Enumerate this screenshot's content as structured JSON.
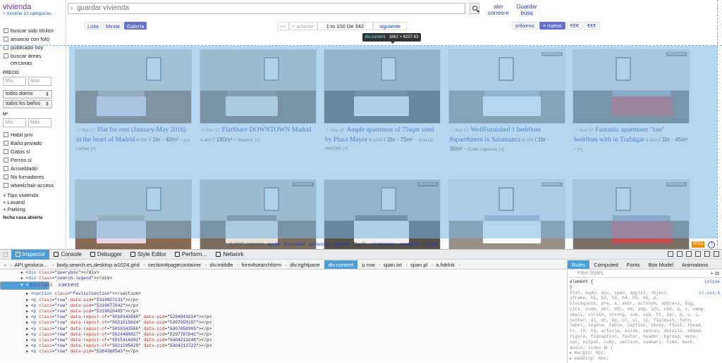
{
  "sidebar": {
    "category": "vivienda",
    "more_link": "+ mostrar 12 categorías",
    "checks1": [
      "buscar solo títulos",
      "anuncio con foto",
      "publicado hoy",
      "buscar áreas cercanas"
    ],
    "price_label": "PRECIO",
    "min": "Mín.",
    "max": "Máx.",
    "bedrooms": "todos dorms",
    "baths": "todos los baños",
    "m2_label": "M²",
    "checks2": [
      "Habit priv",
      "Baño privado",
      "Gatos sí",
      "Perros sí",
      "Amueblado",
      "No fumadores",
      "wheelchair access"
    ],
    "expanders": [
      "+ Tipo vivienda",
      "+ Lavand",
      "+ Parking"
    ],
    "cut_text": "fecha casa abierta"
  },
  "header": {
    "search_placeholder": "guardar vivienda",
    "alert_label": "aler correo-e",
    "save_label": "Guardar búsq",
    "views": [
      "Lista",
      "Miniat",
      "Galería"
    ],
    "prev": "<<",
    "prev2": "< anterior",
    "count": "1 to 100 De 342",
    "next": "siguiente",
    "proximo": "próximo",
    "nuevo": "+ nuevo",
    "cur1": "€€€",
    "cur2": "€€€"
  },
  "tooltip": {
    "tag": "div.content",
    "size": "1662 × 6237.63"
  },
  "listings": [
    {
      "date": "Nov 17",
      "title": "Flat for rent (January-May 2016) in the heart of Madrid",
      "price": "€-500",
      "meta": "/ 1br - 40m² -",
      "loc": "(La Latina)",
      "x": "[×]",
      "badge": ""
    },
    {
      "date": "Nov 17",
      "title": "FlatShare DOWNTOWN Madrid",
      "price": "€-400",
      "meta": "/ 180m² -",
      "loc": "(Madrid)",
      "x": "[×]",
      "badge": ""
    },
    {
      "date": "Nov 17",
      "title": "Ample apartment of 75sqm sited by Plaza Mayor",
      "price": "€-1000",
      "meta": "/ 2br - 75m² -",
      "loc": "(CALLE MAYOR)",
      "x": "[×]",
      "badge": ""
    },
    {
      "date": "Nov 17",
      "title": "WellFurnished 1 bedr0om #apart#ment in Salamanca",
      "price": "€-750",
      "meta": "/ 1br - 30m² -",
      "loc": "(Calle Lagasca)",
      "x": "[×]",
      "badge": "ideal-istaos"
    },
    {
      "date": "Nov 17",
      "title": "Fantastic apartment \"1ne\" bedr0om with in Trafalgar",
      "price": "€-800",
      "meta": "/ 1br - 45m² -",
      "loc": "",
      "x": "[×]",
      "badge": "ideal-istaos"
    },
    {
      "badge": ""
    },
    {
      "badge": "ideal-istaos"
    },
    {
      "badge": "ideal-istaos"
    },
    {
      "badge": "ideal-istaos"
    },
    {
      "badge": "ideal-istaos"
    }
  ],
  "footer": [
    "© 2015 craigslist",
    "ayuda",
    "Seguridad",
    "privacidad",
    "opinión",
    "Trs CL",
    "condiciones",
    "acerca de",
    "mobile"
  ],
  "rss": "RSS",
  "help": "?",
  "devtools": {
    "tabs": [
      "Inspector",
      "Console",
      "Debugger",
      "Style Editor",
      "Perform…",
      "Network"
    ],
    "breadcrumb": [
      "API.geoloca…",
      "body.search.es.desktop.w1024.grid",
      "section#pagecontainer",
      "div.middle",
      "form#searchform",
      "div.rightpane",
      "div.content",
      "p.row",
      "span.txt",
      "span.pl",
      "a.hdrlnk"
    ],
    "tree": [
      {
        "indent": "        ",
        "open": "▸ ",
        "tag": "div",
        "cls": "querybox",
        "tail": "></div>"
      },
      {
        "indent": "        ",
        "open": "▸ ",
        "tag": "div",
        "cls": "search-legend",
        "tail": "></div>"
      },
      {
        "indent": "      ",
        "open": "▾ ",
        "tag": "div",
        "cls": "content",
        "tail": ">",
        "sel": true
      },
      {
        "indent": "          ",
        "open": "▸ ",
        "tag": "section",
        "cls": "favlistsection",
        "tail": "></section>"
      },
      {
        "indent": "          ",
        "open": "▸ ",
        "tag": "p",
        "cls": "row",
        "pid": "5319827131",
        "tail": "></p>"
      },
      {
        "indent": "          ",
        "open": "▸ ",
        "tag": "p",
        "cls": "row",
        "pid": "5319677042",
        "tail": "></p>"
      },
      {
        "indent": "          ",
        "open": "▸ ",
        "tag": "p",
        "cls": "row",
        "pid": "5319620405",
        "tail": "></p>"
      },
      {
        "indent": "          ",
        "open": "▸ ",
        "tag": "p",
        "cls": "row",
        "repost": "5018343566",
        "pid": "5294843214",
        "tail": "></p>"
      },
      {
        "indent": "          ",
        "open": "▸ ",
        "tag": "p",
        "cls": "row",
        "repost": "5021519624",
        "pid": "5307058187",
        "tail": "></p>"
      },
      {
        "indent": "          ",
        "open": "▸ ",
        "tag": "p",
        "cls": "row",
        "repost": "5018343566",
        "pid": "5307058905",
        "tail": "></p>"
      },
      {
        "indent": "          ",
        "open": "▸ ",
        "tag": "p",
        "cls": "row",
        "repost": "5024488827",
        "pid": "5297787842",
        "tail": "></p>"
      },
      {
        "indent": "          ",
        "open": "▸ ",
        "tag": "p",
        "cls": "row",
        "repost": "5015316282",
        "pid": "5304213248",
        "tail": "></p>"
      },
      {
        "indent": "          ",
        "open": "▸ ",
        "tag": "p",
        "cls": "row",
        "repost": "5021295428",
        "pid": "5304213723",
        "tail": "></p>"
      },
      {
        "indent": "          ",
        "open": "▸ ",
        "tag": "p",
        "cls": "row",
        "pid": "5284368543",
        "tail": "></p>"
      }
    ],
    "rule_tabs": [
      "Rules",
      "Computed",
      "Fonts",
      "Box Model",
      "Animations"
    ],
    "filter": "Filter Styles",
    "rule_lines": [
      {
        "l": "element {",
        "r": "inline"
      },
      {
        "l": "}",
        "r": ""
      },
      {
        "l": "html, body, div, span, applet, object,",
        "r": "cl.css:1"
      },
      {
        "l": "iframe, h1, h2, h3, h4, h5, h6, p,",
        "r": ""
      },
      {
        "l": "blockquote, pre, a, abbr, acronym, address, big,",
        "r": ""
      },
      {
        "l": "cite, code, del, dfn, em, img, ins, kbd, q, s, samp,",
        "r": ""
      },
      {
        "l": "small, strike, strong, sub, sup, tt, var, b, u, i,",
        "r": ""
      },
      {
        "l": "center, dl, dt, dd, ol, ul, li, fieldset, form,",
        "r": ""
      },
      {
        "l": "label, legend, table, caption, tbody, tfoot, thead,",
        "r": ""
      },
      {
        "l": "tr, th, td, article, aside, canvas, details, embed,",
        "r": ""
      },
      {
        "l": "figure, figcaption, footer, header, hgroup, menu,",
        "r": ""
      },
      {
        "l": "nav, output, ruby, section, summary, time, mark,",
        "r": ""
      },
      {
        "l": "audio, video ⚙ {",
        "r": ""
      },
      {
        "l": "  ▸ margin: 0px;",
        "r": ""
      },
      {
        "l": "  ▸ padding: 0px;",
        "r": ""
      }
    ]
  }
}
